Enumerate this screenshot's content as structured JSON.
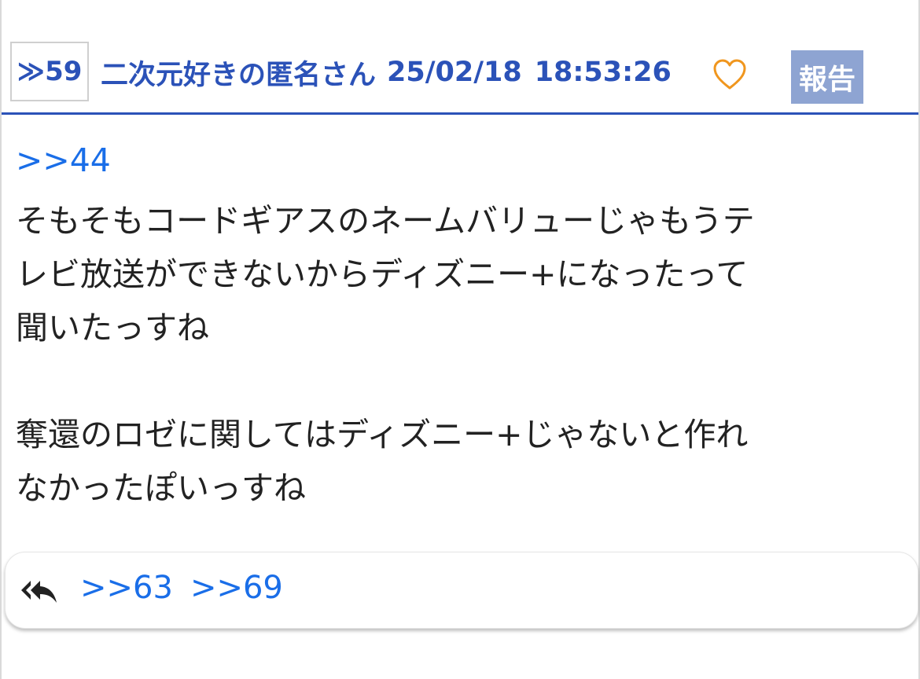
{
  "post": {
    "number_label": "≫59",
    "author": "二次元好きの匿名さん",
    "date": "25/02/18",
    "time": "18:53:26",
    "report_label": "報告",
    "anchor": ">>44",
    "paragraph1": "そもそもコードギアスのネームバリューじゃもうテ\nレビ放送ができないからディズニー+になったって\n聞いたっすね",
    "paragraph2": "奪還のロゼに関してはディズニー+じゃないと作れ\nなかったぽいっすね"
  },
  "replies": {
    "links": [
      ">>63",
      ">>69"
    ]
  },
  "colors": {
    "accent": "#2b52b8",
    "link": "#1a6ee8",
    "heart": "#f0961e",
    "report_bg": "#8ea4d2"
  },
  "icons": {
    "heart": "heart-icon",
    "reply": "reply-all-icon"
  }
}
